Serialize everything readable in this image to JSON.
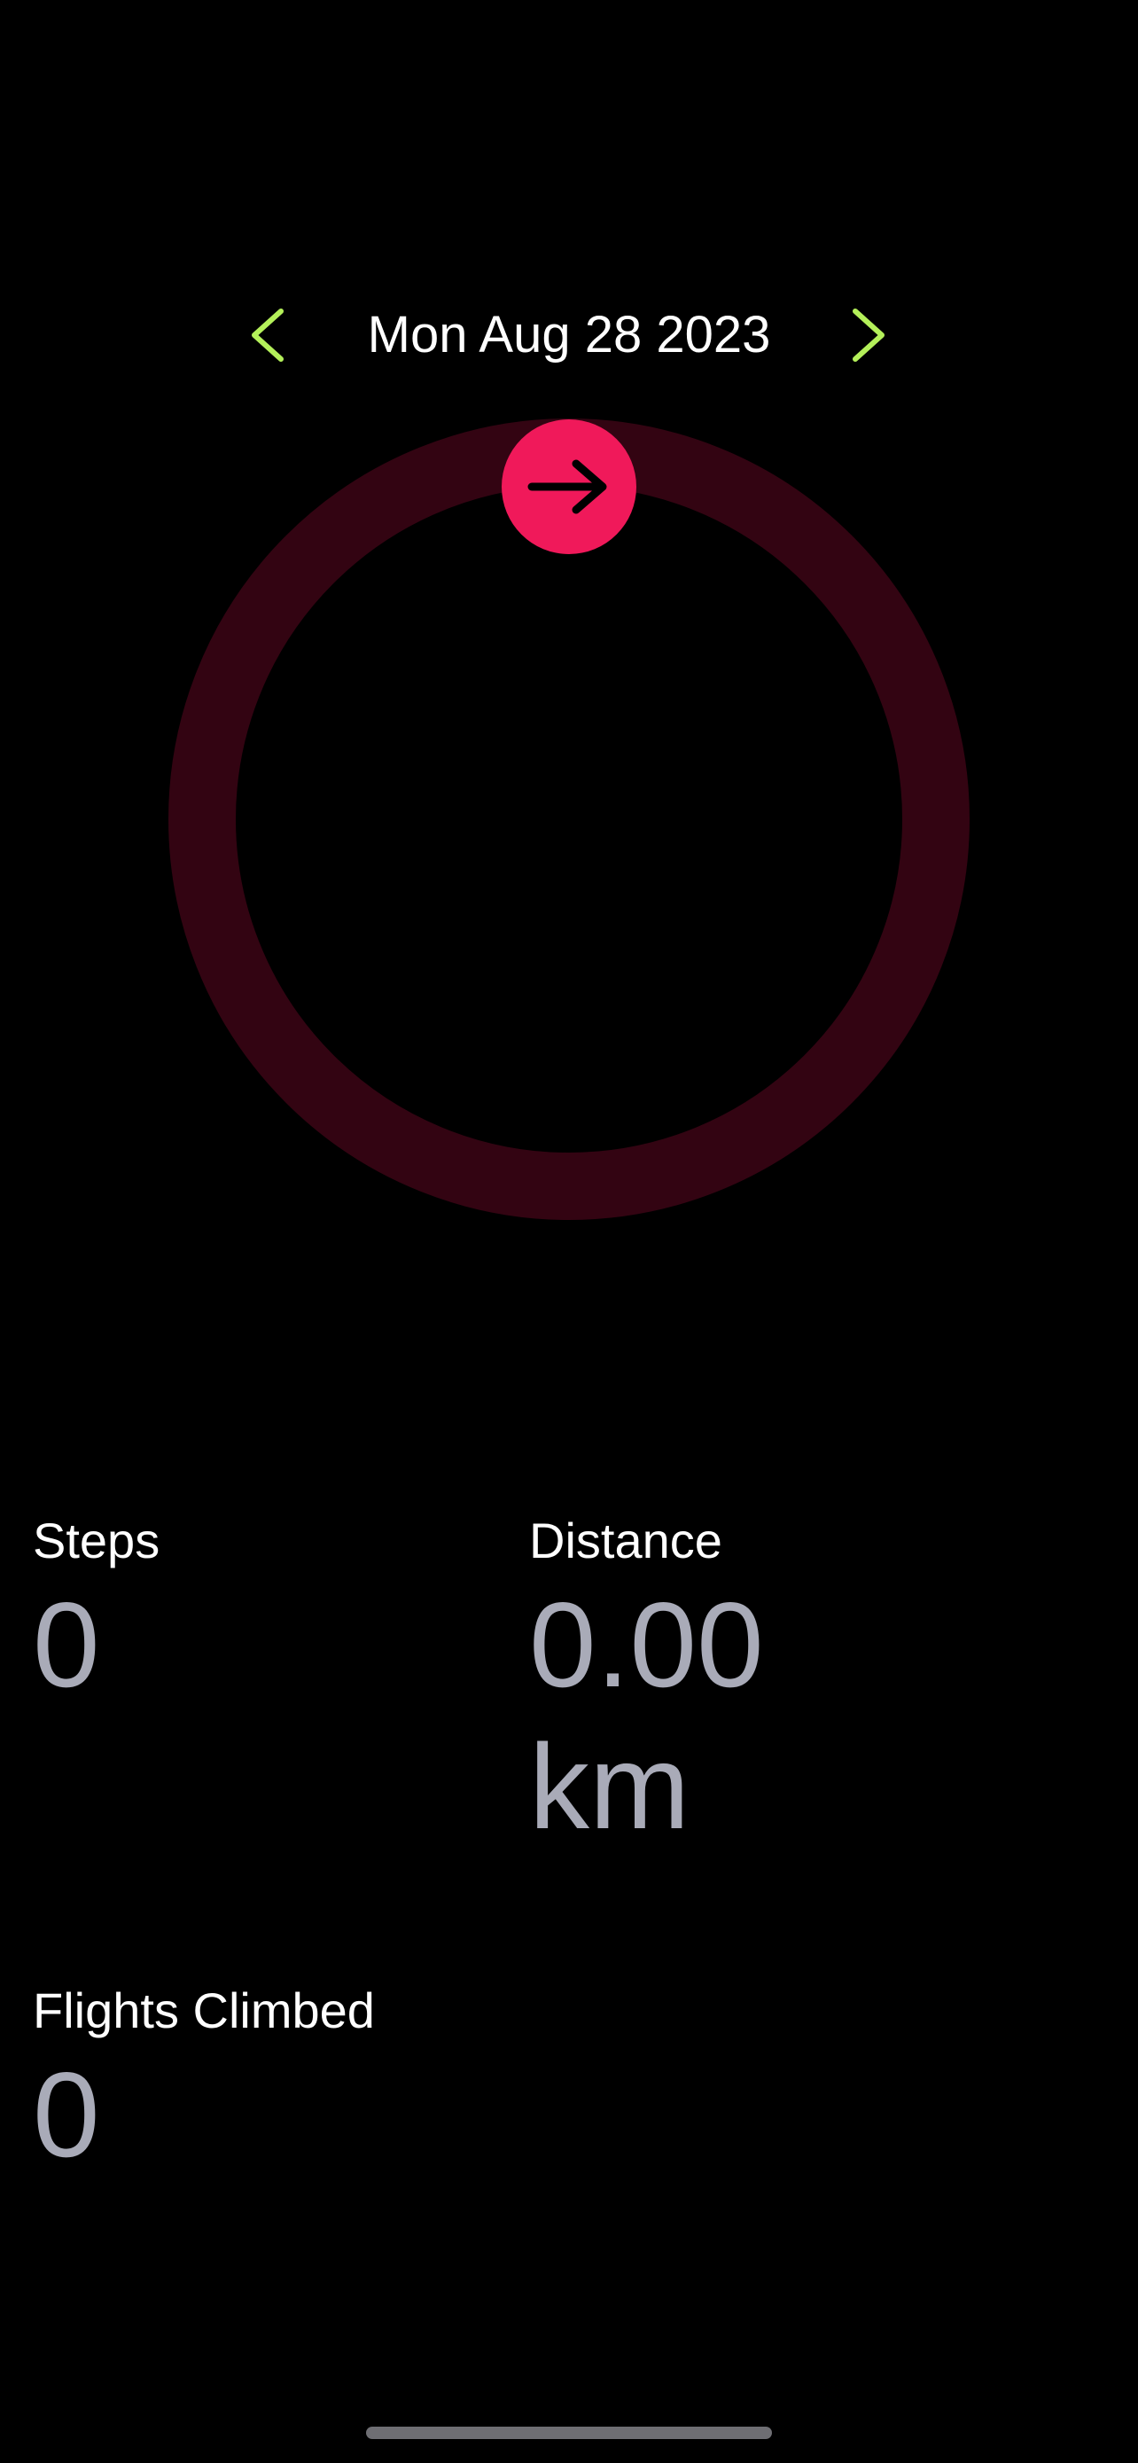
{
  "header": {
    "date": "Mon Aug 28 2023"
  },
  "colors": {
    "background": "#000000",
    "accent_nav": "#b4f05a",
    "ring_track": "#330412",
    "ring_button": "#f0195a",
    "value_text": "#a9abb8"
  },
  "icons": {
    "prev": "chevron-left-icon",
    "next": "chevron-right-icon",
    "ring_button": "arrow-right-icon"
  },
  "ring": {
    "progress": 0
  },
  "stats": {
    "steps": {
      "label": "Steps",
      "value": "0"
    },
    "distance": {
      "label": "Distance",
      "value": "0.00 km"
    },
    "flights": {
      "label": "Flights Climbed",
      "value": "0"
    }
  }
}
